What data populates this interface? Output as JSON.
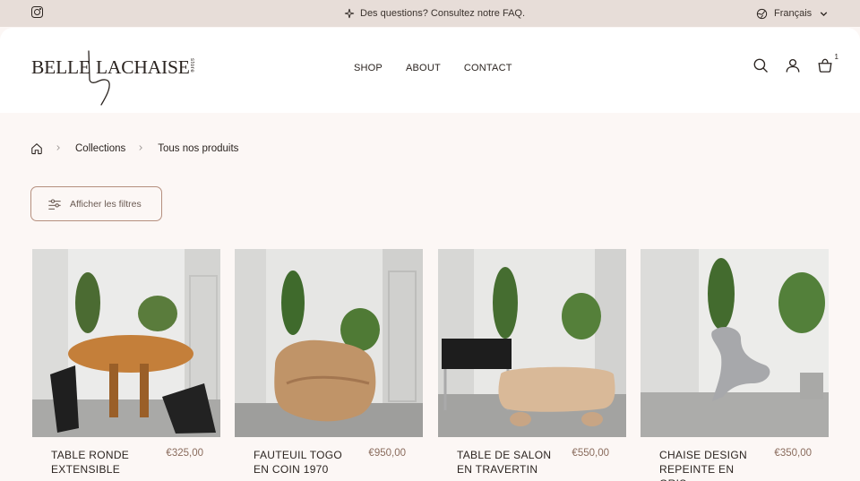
{
  "announcement": {
    "message": "Des questions? Consultez notre FAQ.",
    "language": "Français"
  },
  "header": {
    "logo_left": "BELLE",
    "logo_right": "LACHAISE",
    "logo_tag": "store",
    "nav": [
      "SHOP",
      "ABOUT",
      "CONTACT"
    ],
    "cart_count": "1"
  },
  "breadcrumb": {
    "items": [
      "Collections",
      "Tous nos produits"
    ]
  },
  "filters": {
    "label": "Afficher les filtres"
  },
  "products": [
    {
      "name": "TABLE RONDE EXTENSIBLE",
      "price": "€325,00"
    },
    {
      "name": "FAUTEUIL TOGO EN COIN 1970",
      "price": "€950,00"
    },
    {
      "name": "TABLE DE SALON EN TRAVERTIN",
      "price": "€550,00"
    },
    {
      "name": "CHAISE DESIGN REPEINTE EN GRIS",
      "price": "€350,00"
    }
  ],
  "colors": {
    "announcement_bg": "#e7ddd8",
    "page_bg": "#fcf7f5",
    "accent_border": "#b58f7e",
    "price": "#8a6c5d"
  },
  "icons": [
    "instagram-icon",
    "sparkle-icon",
    "globe-icon",
    "chevron-down-icon",
    "search-icon",
    "account-icon",
    "cart-icon",
    "home-icon",
    "chevron-right-icon",
    "filter-icon"
  ]
}
